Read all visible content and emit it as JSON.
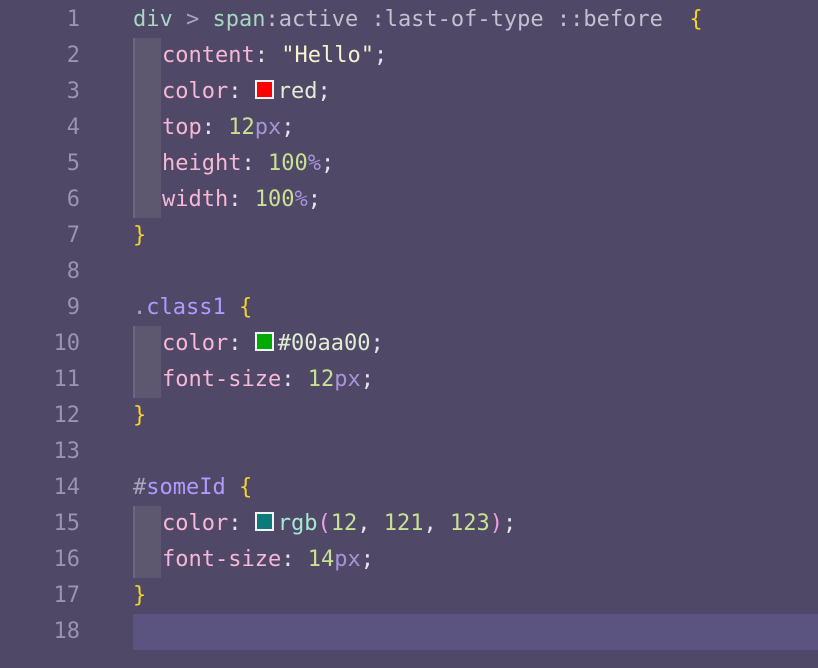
{
  "editor": {
    "language": "css",
    "current_line": 18,
    "swatch_colors": {
      "red": "#ff0000",
      "green": "#00aa00",
      "teal": "#0c797b"
    },
    "line_numbers": [
      "1",
      "2",
      "3",
      "4",
      "5",
      "6",
      "7",
      "8",
      "9",
      "10",
      "11",
      "12",
      "13",
      "14",
      "15",
      "16",
      "17",
      "18"
    ],
    "lines": [
      {
        "tokens": [
          {
            "t": "div",
            "c": "tag"
          },
          {
            "t": " > ",
            "c": "op"
          },
          {
            "t": "span",
            "c": "tag"
          },
          {
            "t": ":active",
            "c": "pseudo"
          },
          {
            "t": " :last-of-type",
            "c": "pseudo"
          },
          {
            "t": " ::before",
            "c": "pseudo"
          },
          {
            "t": "  ",
            "c": "op"
          },
          {
            "t": "{",
            "c": "brace"
          }
        ]
      },
      {
        "indent": 1,
        "tokens": [
          {
            "t": "content",
            "c": "prop"
          },
          {
            "t": ": ",
            "c": "punct"
          },
          {
            "t": "\"Hello\"",
            "c": "str"
          },
          {
            "t": ";",
            "c": "punct"
          }
        ]
      },
      {
        "indent": 1,
        "tokens": [
          {
            "t": "color",
            "c": "prop"
          },
          {
            "t": ": ",
            "c": "punct"
          },
          {
            "swatch": "red"
          },
          {
            "t": "red",
            "c": "word"
          },
          {
            "t": ";",
            "c": "punct"
          }
        ]
      },
      {
        "indent": 1,
        "tokens": [
          {
            "t": "top",
            "c": "prop"
          },
          {
            "t": ": ",
            "c": "punct"
          },
          {
            "t": "12",
            "c": "num"
          },
          {
            "t": "px",
            "c": "unit"
          },
          {
            "t": ";",
            "c": "punct"
          }
        ]
      },
      {
        "indent": 1,
        "tokens": [
          {
            "t": "height",
            "c": "prop"
          },
          {
            "t": ": ",
            "c": "punct"
          },
          {
            "t": "100",
            "c": "num"
          },
          {
            "t": "%",
            "c": "unit"
          },
          {
            "t": ";",
            "c": "punct"
          }
        ]
      },
      {
        "indent": 1,
        "tokens": [
          {
            "t": "width",
            "c": "prop"
          },
          {
            "t": ": ",
            "c": "punct"
          },
          {
            "t": "100",
            "c": "num"
          },
          {
            "t": "%",
            "c": "unit"
          },
          {
            "t": ";",
            "c": "punct"
          }
        ]
      },
      {
        "tokens": [
          {
            "t": "}",
            "c": "brace"
          }
        ]
      },
      {
        "tokens": []
      },
      {
        "tokens": [
          {
            "t": ".",
            "c": "op"
          },
          {
            "t": "class1",
            "c": "cls"
          },
          {
            "t": " ",
            "c": "op"
          },
          {
            "t": "{",
            "c": "brace"
          }
        ]
      },
      {
        "indent": 1,
        "tokens": [
          {
            "t": "color",
            "c": "prop"
          },
          {
            "t": ": ",
            "c": "punct"
          },
          {
            "swatch": "green"
          },
          {
            "t": "#00aa00",
            "c": "word"
          },
          {
            "t": ";",
            "c": "punct"
          }
        ]
      },
      {
        "indent": 1,
        "tokens": [
          {
            "t": "font-size",
            "c": "prop"
          },
          {
            "t": ": ",
            "c": "punct"
          },
          {
            "t": "12",
            "c": "num"
          },
          {
            "t": "px",
            "c": "unit"
          },
          {
            "t": ";",
            "c": "punct"
          }
        ]
      },
      {
        "tokens": [
          {
            "t": "}",
            "c": "brace"
          }
        ]
      },
      {
        "tokens": []
      },
      {
        "tokens": [
          {
            "t": "#",
            "c": "op"
          },
          {
            "t": "someId",
            "c": "cls"
          },
          {
            "t": " ",
            "c": "op"
          },
          {
            "t": "{",
            "c": "brace"
          }
        ]
      },
      {
        "indent": 1,
        "tokens": [
          {
            "t": "color",
            "c": "prop"
          },
          {
            "t": ": ",
            "c": "punct"
          },
          {
            "swatch": "teal"
          },
          {
            "t": "rgb",
            "c": "fn"
          },
          {
            "t": "(",
            "c": "paren"
          },
          {
            "t": "12",
            "c": "num"
          },
          {
            "t": ", ",
            "c": "punct"
          },
          {
            "t": "121",
            "c": "num"
          },
          {
            "t": ", ",
            "c": "punct"
          },
          {
            "t": "123",
            "c": "num"
          },
          {
            "t": ")",
            "c": "paren"
          },
          {
            "t": ";",
            "c": "punct"
          }
        ]
      },
      {
        "indent": 1,
        "tokens": [
          {
            "t": "font-size",
            "c": "prop"
          },
          {
            "t": ": ",
            "c": "punct"
          },
          {
            "t": "14",
            "c": "num"
          },
          {
            "t": "px",
            "c": "unit"
          },
          {
            "t": ";",
            "c": "punct"
          }
        ]
      },
      {
        "tokens": [
          {
            "t": "}",
            "c": "brace"
          }
        ]
      },
      {
        "tokens": []
      }
    ]
  }
}
